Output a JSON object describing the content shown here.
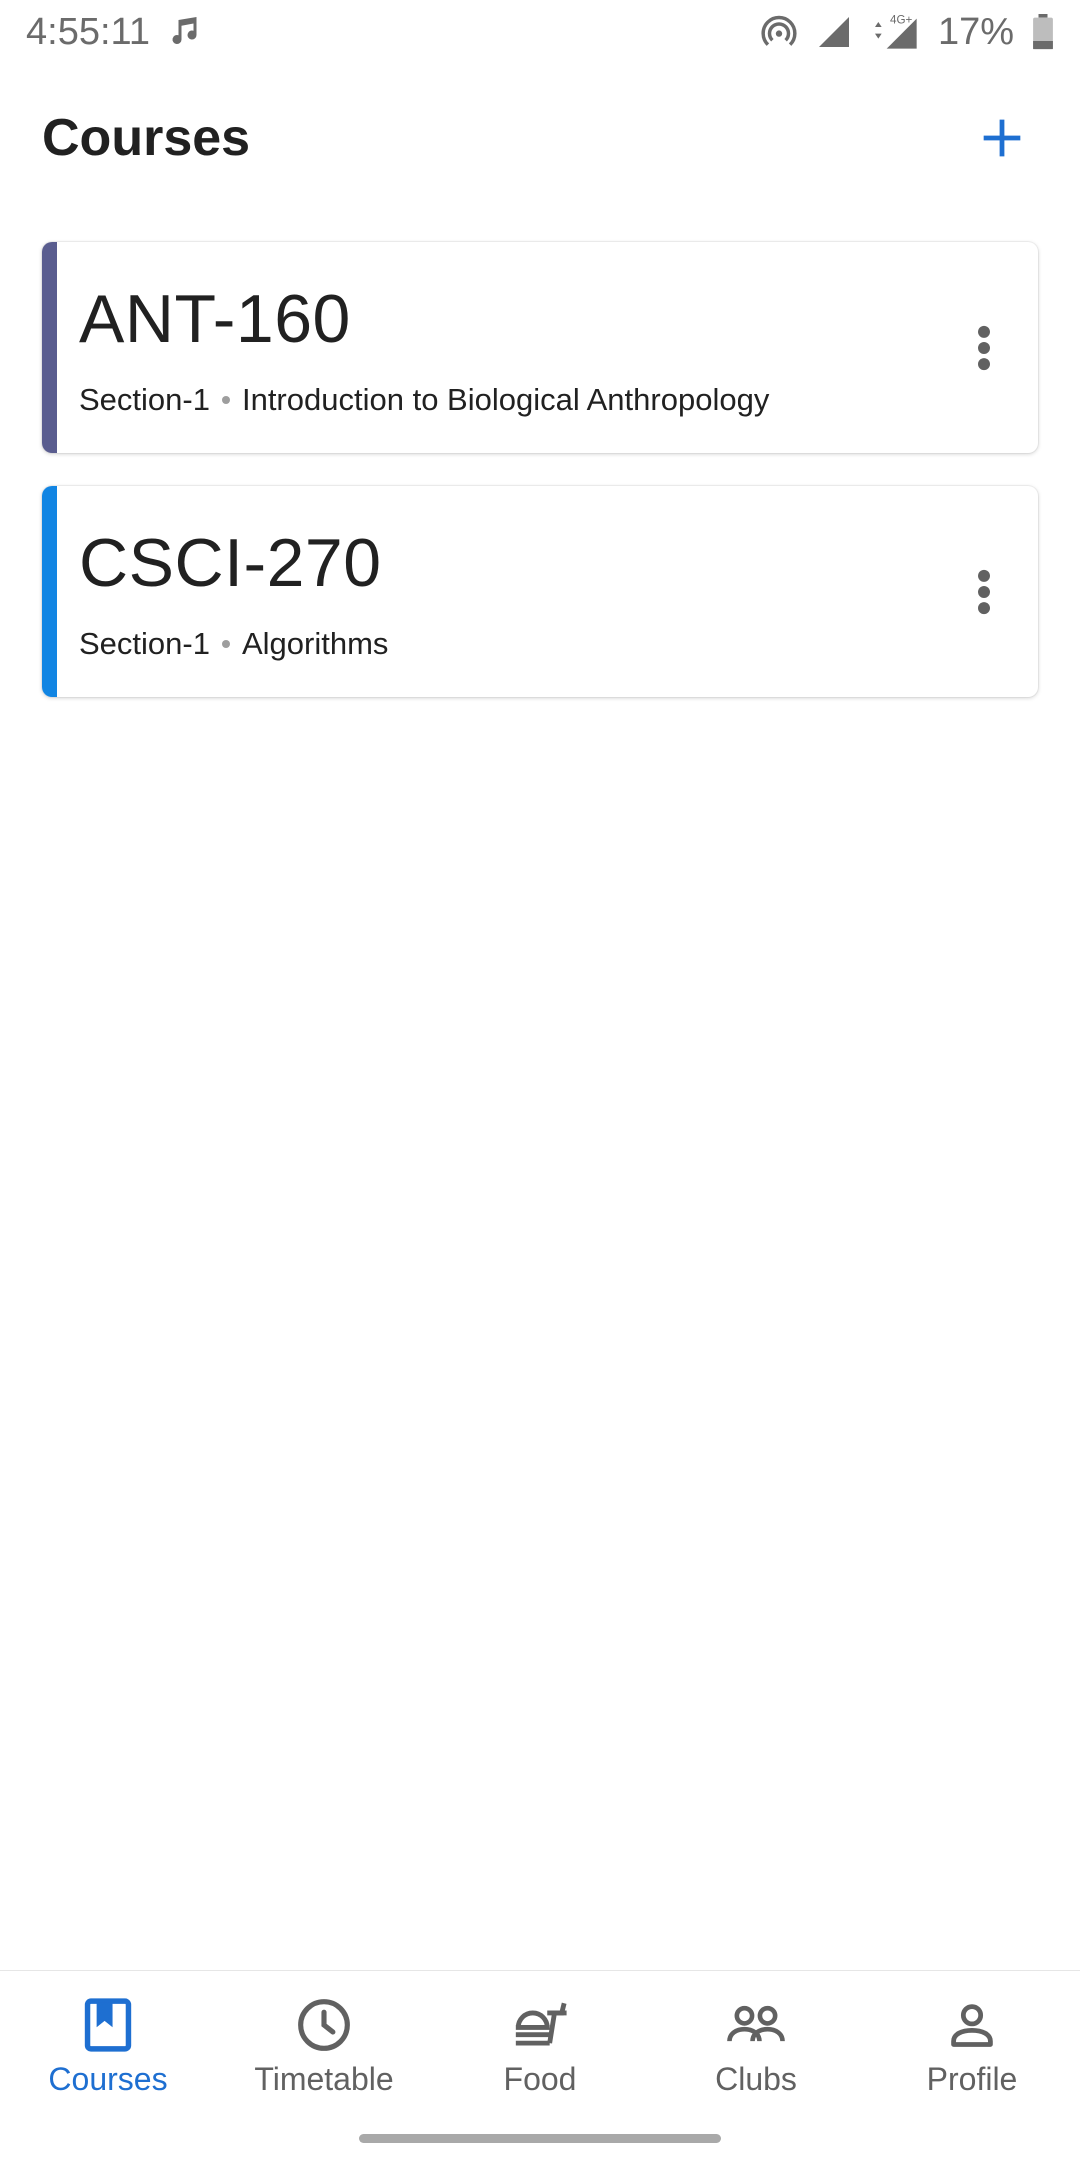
{
  "status_bar": {
    "time": "4:55:11",
    "battery": "17%",
    "network": "4G+",
    "icons": [
      "music-note-icon",
      "hotspot-icon",
      "signal-icon",
      "lte-signal-icon",
      "battery-icon"
    ]
  },
  "header": {
    "title": "Courses",
    "add_icon": "plus-icon",
    "accent_color": "#1e6fd1"
  },
  "courses": [
    {
      "code": "ANT-160",
      "section": "Section-1",
      "name": "Introduction to Biological Anthropology",
      "color": "#5a5d8f"
    },
    {
      "code": "CSCI-270",
      "section": "Section-1",
      "name": "Algorithms",
      "color": "#1185e3"
    }
  ],
  "bottom_nav": {
    "items": [
      {
        "label": "Courses",
        "icon": "bookmark-book-icon",
        "active": true
      },
      {
        "label": "Timetable",
        "icon": "clock-icon",
        "active": false
      },
      {
        "label": "Food",
        "icon": "food-icon",
        "active": false
      },
      {
        "label": "Clubs",
        "icon": "group-icon",
        "active": false
      },
      {
        "label": "Profile",
        "icon": "person-icon",
        "active": false
      }
    ],
    "active_color": "#1e6fd1",
    "inactive_color": "#616161"
  }
}
